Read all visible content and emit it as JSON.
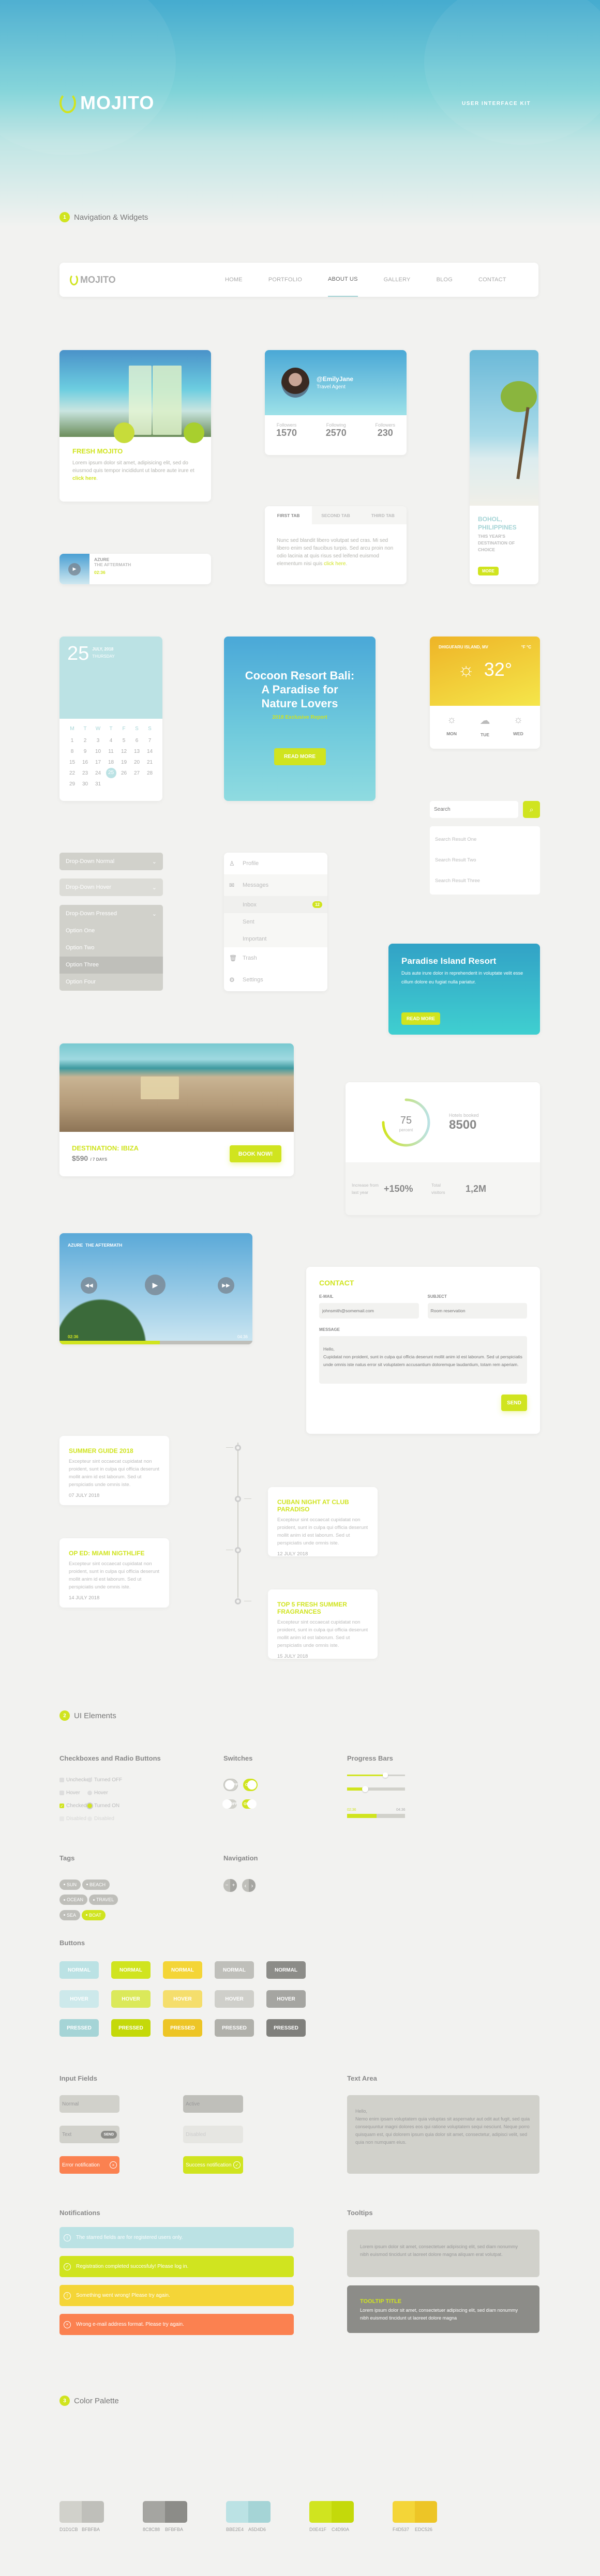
{
  "hero": {
    "brand": "MOJITO",
    "tagline": "USER INTERFACE KIT"
  },
  "sections": [
    {
      "num": "1",
      "title": "Navigation & Widgets"
    },
    {
      "num": "2",
      "title": "UI Elements"
    },
    {
      "num": "3",
      "title": "Color Palette"
    }
  ],
  "navbar": {
    "brand": "MOJITO",
    "items": [
      "HOME",
      "PORTFOLIO",
      "ABOUT US",
      "GALLERY",
      "BLOG",
      "CONTACT"
    ],
    "active": "ABOUT US"
  },
  "mojito_card": {
    "title": "FRESH MOJITO",
    "body": "Lorem ipsum dolor sit amet, adipisicing elit, sed do eiusmod quis tempor incididunt ut labore aute irure et ",
    "link": "click here",
    "end": "."
  },
  "profile_card": {
    "handle": "@EmilyJane",
    "role": "Travel Agent",
    "stats": [
      {
        "label": "Followers",
        "value": "1570"
      },
      {
        "label": "Following",
        "value": "2570"
      },
      {
        "label": "Followers",
        "value": "230"
      }
    ]
  },
  "destination_card": {
    "title_line1": "BOHOL,",
    "title_line2": "PHILIPPINES",
    "subtitle": "THIS YEAR'S DESTINATION OF CHOICE",
    "button": "MORE"
  },
  "mini_player": {
    "artist": "AZURE",
    "track": "THE AFTERMATH",
    "time": "02:36"
  },
  "tabs_card": {
    "tabs": [
      "FIRST TAB",
      "SECOND TAB",
      "THIRD TAB"
    ],
    "active": "FIRST TAB",
    "body": "Nunc sed blandit libero volutpat sed cras. Mi sed libero enim sed faucibus turpis. Sed arcu proin non odio lacinia at quis risus sed leifend euismod elementum nisi quis ",
    "link": "click here",
    "end": "."
  },
  "calendar": {
    "day": "25",
    "month_year": "JULY, 2018",
    "weekday": "THURSDAY",
    "weekdays": [
      "M",
      "T",
      "W",
      "T",
      "F",
      "S",
      "S"
    ],
    "days": [
      "1",
      "2",
      "3",
      "4",
      "5",
      "6",
      "7",
      "8",
      "9",
      "10",
      "11",
      "12",
      "13",
      "14",
      "15",
      "16",
      "17",
      "18",
      "19",
      "20",
      "21",
      "22",
      "23",
      "24",
      "25",
      "26",
      "27",
      "28",
      "29",
      "30",
      "31"
    ],
    "selected": "25"
  },
  "promo_card": {
    "title": "Cocoon Resort Bali: A Paradise for Nature Lovers",
    "subtitle": "2018 Exclusive Report",
    "button": "READ MORE"
  },
  "weather": {
    "location": "DHIGUFARU ISLAND, MV",
    "units": [
      "°F",
      "°C"
    ],
    "temp": "32°",
    "forecast": [
      {
        "day": "MON",
        "icon": "sun-icon"
      },
      {
        "day": "TUE",
        "icon": "cloud-icon"
      },
      {
        "day": "WED",
        "icon": "sun-icon"
      }
    ]
  },
  "search": {
    "placeholder": "Search",
    "results": [
      "Search Result One",
      "Search Result Two",
      "Search Result Three"
    ]
  },
  "dropdowns": {
    "normal": "Drop-Down Normal",
    "hover": "Drop-Down Hover",
    "pressed": "Drop-Down Pressed",
    "options": [
      "Option One",
      "Option Two",
      "Option Three",
      "Option Four"
    ],
    "highlighted": "Option Three"
  },
  "side_menu": {
    "items": [
      {
        "label": "Profile",
        "icon": "user-icon"
      },
      {
        "label": "Messages",
        "icon": "mail-icon"
      },
      {
        "label": "Inbox",
        "badge": "12"
      },
      {
        "label": "Sent"
      },
      {
        "label": "Important"
      },
      {
        "label": "Trash",
        "icon": "trash-icon"
      },
      {
        "label": "Settings",
        "icon": "gear-icon"
      }
    ]
  },
  "island_card": {
    "title": "Paradise Island Resort",
    "body": "Duis aute irure dolor in reprehenderit in voluptate velit esse cillum dolore eu fugiat nulla pariatur.",
    "button": "READ MORE"
  },
  "ibiza_card": {
    "title": "DESTINATION: IBIZA",
    "price": "$590",
    "duration": "/ 7 DAYS",
    "button": "BOOK NOW!"
  },
  "stats_card": {
    "percent": 75,
    "percent_label": "percent",
    "hotels_label": "Hotels booked",
    "hotels_value": "8500",
    "increase_label": "Increase from last year",
    "increase_value": "+150%",
    "visitors_label": "Total visitors",
    "visitors_value": "1,2M"
  },
  "video_player": {
    "title": "AZURE  THE AFTERMATH",
    "current": "02:36",
    "total": "04:36",
    "progress": 0.52
  },
  "contact": {
    "title": "CONTACT",
    "email_label": "E-MAIL",
    "email_placeholder": "johnsmith@somemail.com",
    "subject_label": "SUBJECT",
    "subject_placeholder": "Room reservation",
    "message_label": "MESSAGE",
    "message_placeholder": "Hello,\nCupidatat non proident, sunt in culpa qui officia deserunt mollit anim id est laborum. Sed ut perspiciatis unde omnis iste natus error sit voluptatem accusantium doloremque laudantium, totam rem aperiam.",
    "send": "SEND"
  },
  "timeline": [
    {
      "title": "SUMMER GUIDE 2018",
      "body": "Excepteur sint occaecat cupidatat non proident, sunt in culpa qui officia deserunt mollit anim id est laborum. Sed ut perspiciatis unde omnis iste.",
      "date": "07 JULY 2018"
    },
    {
      "title": "CUBAN NIGHT AT CLUB PARADISO",
      "body": "Excepteur sint occaecat cupidatat non proident, sunt in culpa qui officia deserunt mollit anim id est laborum. Sed ut perspiciatis unde omnis iste.",
      "date": "12 JULY 2018"
    },
    {
      "title": "OP ED: MIAMI NIGTHLIFE",
      "body": "Excepteur sint occaecat cupidatat non proident, sunt in culpa qui officia deserunt mollit anim id est laborum. Sed ut perspiciatis unde omnis iste.",
      "date": "14 JULY 2018"
    },
    {
      "title": "TOP 5 FRESH SUMMER FRAGRANCES",
      "body": "Excepteur sint occaecat cupidatat non proident, sunt in culpa qui officia deserunt mollit anim id est laborum. Sed ut perspiciatis unde omnis iste.",
      "date": "15 JULY 2018"
    }
  ],
  "ui": {
    "checkboxes_title": "Checkboxes and Radio Buttons",
    "checkboxes": [
      "Unchecked",
      "Hover",
      "Checked",
      "Disabled"
    ],
    "radios": [
      "Turned OFF",
      "Hover",
      "Turned ON",
      "Disabled"
    ],
    "switches_title": "Switches",
    "switch_off": "OFF",
    "switch_on": "ON",
    "progress_title": "Progress Bars",
    "slider1": 0.66,
    "slider2": 0.31,
    "progress_current": "02:36",
    "progress_total": "04:36",
    "progress_value": 0.51,
    "tags_title": "Tags",
    "tags": [
      "SUN",
      "BEACH",
      "OCEAN",
      "TRAVEL",
      "SEA",
      "BOAT"
    ],
    "active_tag": "BOAT",
    "navigation_title": "Navigation",
    "stepper": [
      "−",
      "+"
    ],
    "pager": [
      "‹",
      "›"
    ],
    "buttons_title": "Buttons",
    "button_states": [
      "NORMAL",
      "HOVER",
      "PRESSED"
    ],
    "button_colors": [
      [
        "#bbe2e4",
        "#cde9eb",
        "#a5d4d6"
      ],
      [
        "#d0e41f",
        "#dbe95a",
        "#c4d90a"
      ],
      [
        "#f4d537",
        "#f5de6c",
        "#edc526"
      ],
      [
        "#bfbfba",
        "#cfcfca",
        "#b0b0aa"
      ],
      [
        "#8c8c88",
        "#a5a5a1",
        "#80807c"
      ]
    ],
    "inputs_title": "Input Fields",
    "inputs": {
      "normal": "Normal",
      "active": "Active",
      "text": "Text",
      "send": "SEND",
      "disabled": "Disabled",
      "error": "Error notification",
      "success": "Success notification"
    },
    "textarea_title": "Text Area",
    "textarea": "Hello,\nNemo enim ipsam voluptatem quia voluptas sit aspernatur aut odit aut fugit, sed quia consequuntur magni dolores eos qui ratione voluptatem sequi nesciunt. Neque porro quisquam est, qui dolorem ipsum quia dolor sit amet, consectetur, adipisci velit, sed quia non numquam eius.",
    "notifications_title": "Notifications",
    "notifications": [
      {
        "text": "The starred fields are for registered users only.",
        "icon": "info-icon",
        "color": "#bbe2e4"
      },
      {
        "text": "Registration completed succesfuly! Please log in.",
        "icon": "check-circle-icon",
        "color": "#d0e41f"
      },
      {
        "text": "Something went wrong! Please try again.",
        "icon": "warning-icon",
        "color": "#f4d537"
      },
      {
        "text": "Wrong e-mail address format. Please try again.",
        "icon": "error-icon",
        "color": "#fb8150"
      }
    ],
    "tooltips_title": "Tooltips",
    "tooltip1": "Lorem ipsum dolor sit amet, consectetuer adipiscing elit, sed diam nonummy nibh euismod tincidunt ut laoreet dolore magna aliquam erat volutpat.",
    "tooltip2_title": "TOOLTIP TITLE",
    "tooltip2": "Lorem ipsum dolor sit amet, consectetuer adipiscing elit, sed diam nonummy nibh euismod tincidunt ut laoreet dolore magna"
  },
  "palette": [
    {
      "a": "#D1D1CB",
      "b": "#BFBFBA",
      "la": "D1D1CB",
      "lb": "BFBFBA"
    },
    {
      "a": "#A5A5A1",
      "b": "#8C8C88",
      "la": "8C8C88",
      "lb": "BFBFBA"
    },
    {
      "a": "#BBE2E4",
      "b": "#A5D4D6",
      "la": "BBE2E4",
      "lb": "A5D4D6"
    },
    {
      "a": "#D0E41F",
      "b": "#C4D90A",
      "la": "D0E41F",
      "lb": "C4D90A"
    },
    {
      "a": "#F4D537",
      "b": "#EDC526",
      "la": "F4D537",
      "lb": "EDC526"
    }
  ]
}
